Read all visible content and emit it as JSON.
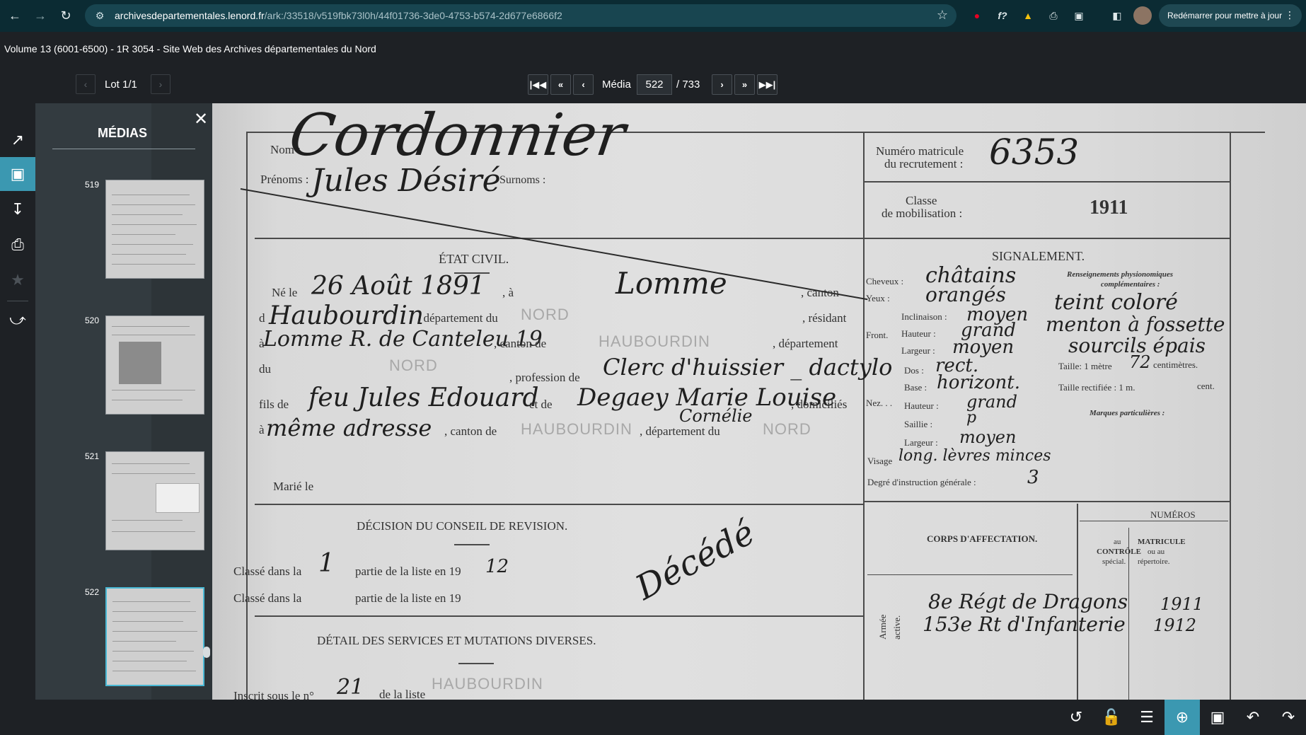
{
  "browser": {
    "url_domain": "archivesdepartementales.lenord.fr",
    "url_path": "/ark:/33518/v519fbk73l0h/44f01736-3de0-4753-b574-2d677e6866f2",
    "restart_label": "Redémarrer pour mettre à jour",
    "icons": [
      "back-icon",
      "forward-icon",
      "reload-icon",
      "site-settings-icon",
      "bookmark-star-icon",
      "pinterest-icon",
      "font-icon",
      "drive-icon",
      "printer-icon",
      "extensions-icon",
      "sidepanel-icon",
      "profile-avatar",
      "menu-dots-icon"
    ]
  },
  "page_title": "Volume 13 (6001-6500) - 1R 3054 - Site Web des Archives départementales du Nord",
  "lot": {
    "label": "Lot 1/1"
  },
  "media_nav": {
    "label": "Média",
    "current": "522",
    "total": "/ 733"
  },
  "panel": {
    "title": "MÉDIAS",
    "thumbnails": [
      {
        "num": "519"
      },
      {
        "num": "520"
      },
      {
        "num": "521"
      },
      {
        "num": "522",
        "selected": true
      }
    ]
  },
  "rail_icons": [
    "open-external-icon",
    "image-icon",
    "download-icon",
    "print-icon",
    "favorite-star-icon",
    "share-icon"
  ],
  "document": {
    "nom_label": "Nom :",
    "nom_value": "Cordonnier",
    "prenoms_label": "Prénoms :",
    "prenoms_value": "Jules Désiré",
    "surnoms_label": "Surnoms :",
    "matricule_label_1": "Numéro matricule",
    "matricule_label_2": "du recrutement :",
    "matricule_value": "6353",
    "classe_label_1": "Classe",
    "classe_label_2": "de mobilisation :",
    "classe_value": "1911",
    "etat_civil": "ÉTAT CIVIL.",
    "ne_le": "Né le",
    "birth_date": "26 Août 1891",
    "a": ", à",
    "birth_place": "Lomme",
    "canton": ", canton",
    "d": "d",
    "canton_value": "Haubourdin",
    "departement_du": ", département du",
    "stamp_nord": "NORD",
    "residant": ", résidant",
    "a2": "à",
    "address": "Lomme R. de Canteleu 19",
    "canton_de": ", canton de",
    "stamp_haubourdin": "HAUBOURDIN",
    "departement": ", département",
    "du": "du",
    "profession_de": ", profession de",
    "profession": "Clerc d'huissier _ dactylo",
    "fils_de": "fils de",
    "father": "feu Jules Edouard",
    "et_de": "et de",
    "mother": "Degaey Marie Louise",
    "mother_2": "Cornélie",
    "domicilies": ", domiciliés",
    "a3": "à",
    "meme_adresse": "même adresse",
    "canton_de2": ", canton de",
    "departement_du2": ", département du",
    "marie_le": "Marié le",
    "signalement": "SIGNALEMENT.",
    "renseignements_1": "Renseignements physionomiques",
    "renseignements_2": "complémentaires :",
    "cheveux_label": "Cheveux :",
    "cheveux": "châtains",
    "yeux_label": "Yeux :",
    "yeux": "orangés",
    "teint": "teint coloré",
    "front_label": "Front.",
    "inclinaison_label": "Inclinaison :",
    "inclinaison": "moyen",
    "hauteur_label": "Hauteur :",
    "hauteur": "grand",
    "largeur_label": "Largeur :",
    "largeur": "moyen",
    "menton": "menton à fossette",
    "sourcils": "sourcils épais",
    "taille_label": "Taille: 1 mètre",
    "taille_value": "72",
    "centimetres": "centimètres.",
    "nez_label": "Nez. . .",
    "dos_label": "Dos :",
    "dos": "rect.",
    "base_label": "Base :",
    "base": "horizont.",
    "hauteur2_label": "Hauteur :",
    "hauteur2": "grand",
    "saillie_label": "Saillie :",
    "saillie": "p",
    "largeur2_label": "Largeur :",
    "largeur2": "moyen",
    "taille_rectifiee": "Taille rectifiée : 1 m.",
    "cent": "cent.",
    "marques": "Marques particulières :",
    "visage_label": "Visage",
    "visage": "long. lèvres minces",
    "degre_label": "Degré d'instruction générale :",
    "degre": "3",
    "decision": "DÉCISION DU CONSEIL DE REVISION.",
    "classe_dans_la_1": "Classé dans la",
    "classe_value_1": "1",
    "partie_1": "partie de la liste en 19",
    "partie_year_1": "12",
    "classe_dans_la_2": "Classé dans la",
    "partie_2": "partie de la liste en 19",
    "decede": "Décédé",
    "corps": "CORPS D'AFFECTATION.",
    "numeros": "NUMÉROS",
    "au_controle_1": "au",
    "au_controle_2": "CONTRÔLE",
    "au_controle_3": "spécial.",
    "matricule_col_1": "MATRICULE",
    "matricule_col_2": "ou au",
    "matricule_col_3": "répertoire.",
    "armee": "Armée",
    "active": "active.",
    "affectation_1": "8e Régt de Dragons",
    "affectation_2": "153e Rt d'Infanterie",
    "year_1": "1911",
    "year_2": "1912",
    "detail": "DÉTAIL DES SERVICES ET MUTATIONS DIVERSES.",
    "inscrit": "Inscrit sous le n°",
    "inscrit_value": "21",
    "de_la_liste": "de la liste"
  },
  "bottom_icons": [
    "history-icon",
    "unlock-icon",
    "adjust-sliders-icon",
    "zoom-in-icon",
    "fit-screen-icon",
    "rotate-left-icon",
    "rotate-right-icon"
  ]
}
